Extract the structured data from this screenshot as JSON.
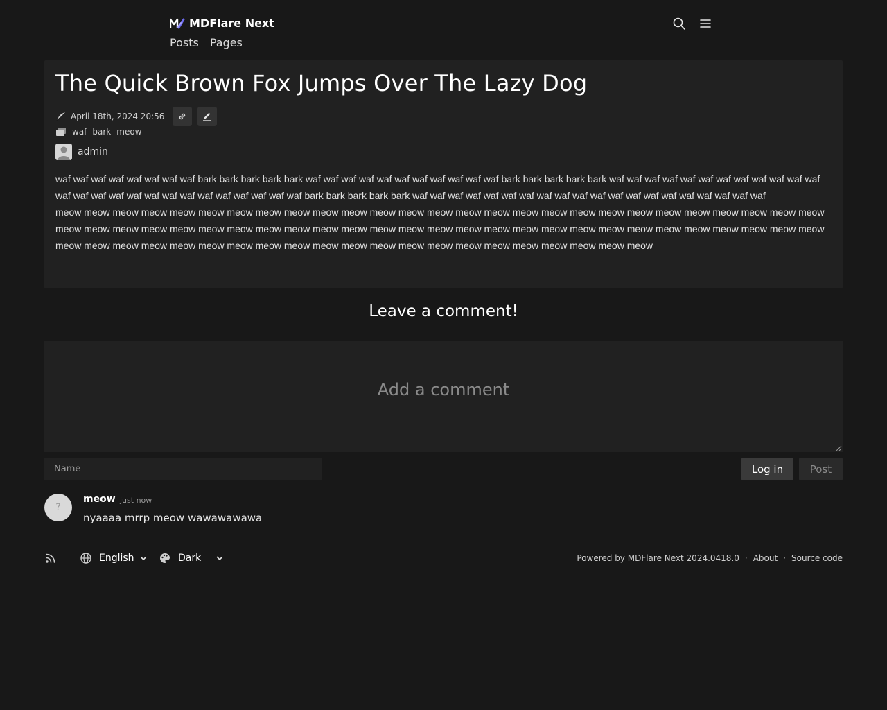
{
  "header": {
    "brand": "MDFlare Next",
    "nav": [
      "Posts",
      "Pages"
    ],
    "icons": [
      "search-icon",
      "menu-icon"
    ]
  },
  "post": {
    "title": "The Quick Brown Fox Jumps Over The Lazy Dog",
    "date": "April 18th, 2024 20:56",
    "tags": [
      "waf",
      "bark",
      "meow"
    ],
    "author": "admin",
    "paragraphs": [
      "waf waf waf waf waf waf waf waf bark bark bark bark bark waf waf waf waf waf waf waf waf waf waf waf bark bark bark bark bark waf waf waf waf waf waf waf waf waf waf waf waf waf waf waf waf waf waf waf waf waf waf waf waf waf waf bark bark bark bark bark waf waf waf waf waf waf waf waf waf waf waf waf waf waf waf waf waf waf waf waf",
      "meow meow meow meow meow meow meow meow meow meow meow meow meow meow meow meow meow meow meow meow meow meow meow meow meow meow meow meow meow meow meow meow meow meow meow meow meow meow meow meow meow meow meow meow meow meow meow meow meow meow meow meow meow meow meow meow meow meow meow meow meow meow meow meow meow meow meow meow meow meow meow meow meow meow meow"
    ]
  },
  "comments": {
    "heading": "Leave a comment!",
    "textarea_placeholder": "Add a comment",
    "name_placeholder": "Name",
    "login_label": "Log in",
    "post_label": "Post",
    "items": [
      {
        "author": "meow",
        "time": "just now",
        "text": "nyaaaa mrrp meow wawawawawa",
        "avatar": "?"
      }
    ]
  },
  "footer": {
    "language": "English",
    "theme": "Dark",
    "powered_by": "Powered by MDFlare Next 2024.0418.0",
    "about": "About",
    "source": "Source code",
    "separator": "·"
  },
  "colors": {
    "background": "#181818",
    "card": "#212121",
    "brand_accent": "#6f6cf0"
  }
}
